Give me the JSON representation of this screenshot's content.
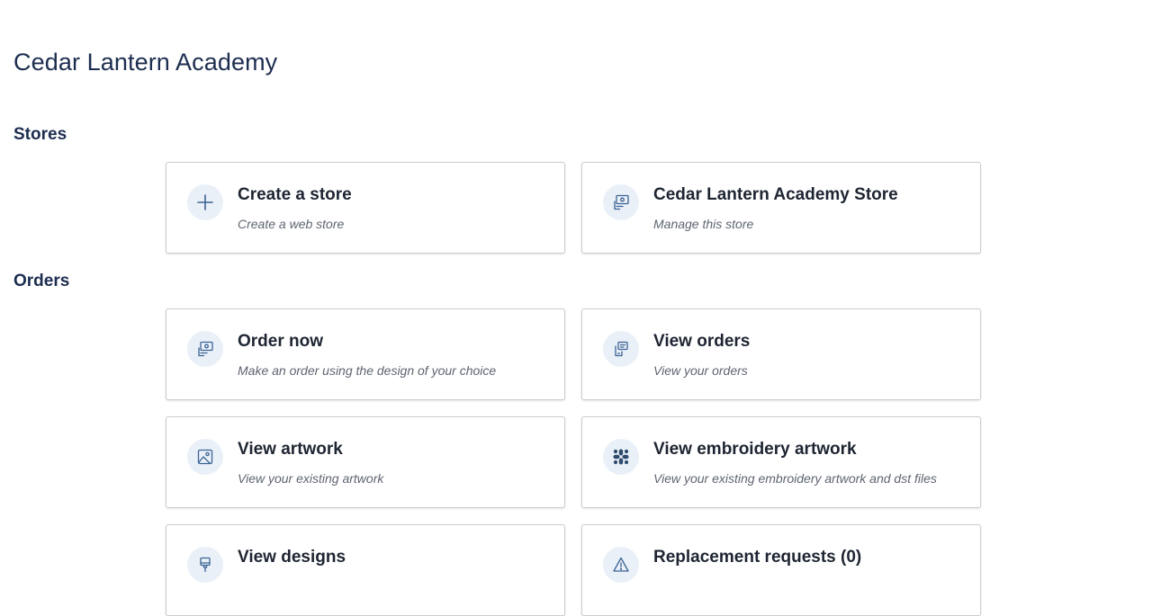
{
  "page": {
    "title": "Cedar Lantern Academy"
  },
  "sections": {
    "stores": {
      "heading": "Stores",
      "cards": [
        {
          "title": "Create a store",
          "subtitle": "Create a web store",
          "icon": "plus-icon"
        },
        {
          "title": "Cedar Lantern Academy Store",
          "subtitle": "Manage this store",
          "icon": "store-display-icon"
        }
      ]
    },
    "orders": {
      "heading": "Orders",
      "cards": [
        {
          "title": "Order now",
          "subtitle": "Make an order using the design of your choice",
          "icon": "order-display-icon"
        },
        {
          "title": "View orders",
          "subtitle": "View your orders",
          "icon": "orders-list-icon"
        },
        {
          "title": "View artwork",
          "subtitle": "View your existing artwork",
          "icon": "image-icon"
        },
        {
          "title": "View embroidery artwork",
          "subtitle": "View your existing embroidery artwork and dst files",
          "icon": "embroidery-icon"
        },
        {
          "title": "View designs",
          "subtitle": "",
          "icon": "paint-brush-icon"
        },
        {
          "title": "Replacement requests (0)",
          "subtitle": "",
          "icon": "warning-icon"
        }
      ]
    }
  },
  "colors": {
    "heading": "#1c2d4f",
    "icon": "#3a6394",
    "icon_background": "#eaf0f8",
    "card_border": "#c9ccd2",
    "subtitle": "#5e6470"
  }
}
